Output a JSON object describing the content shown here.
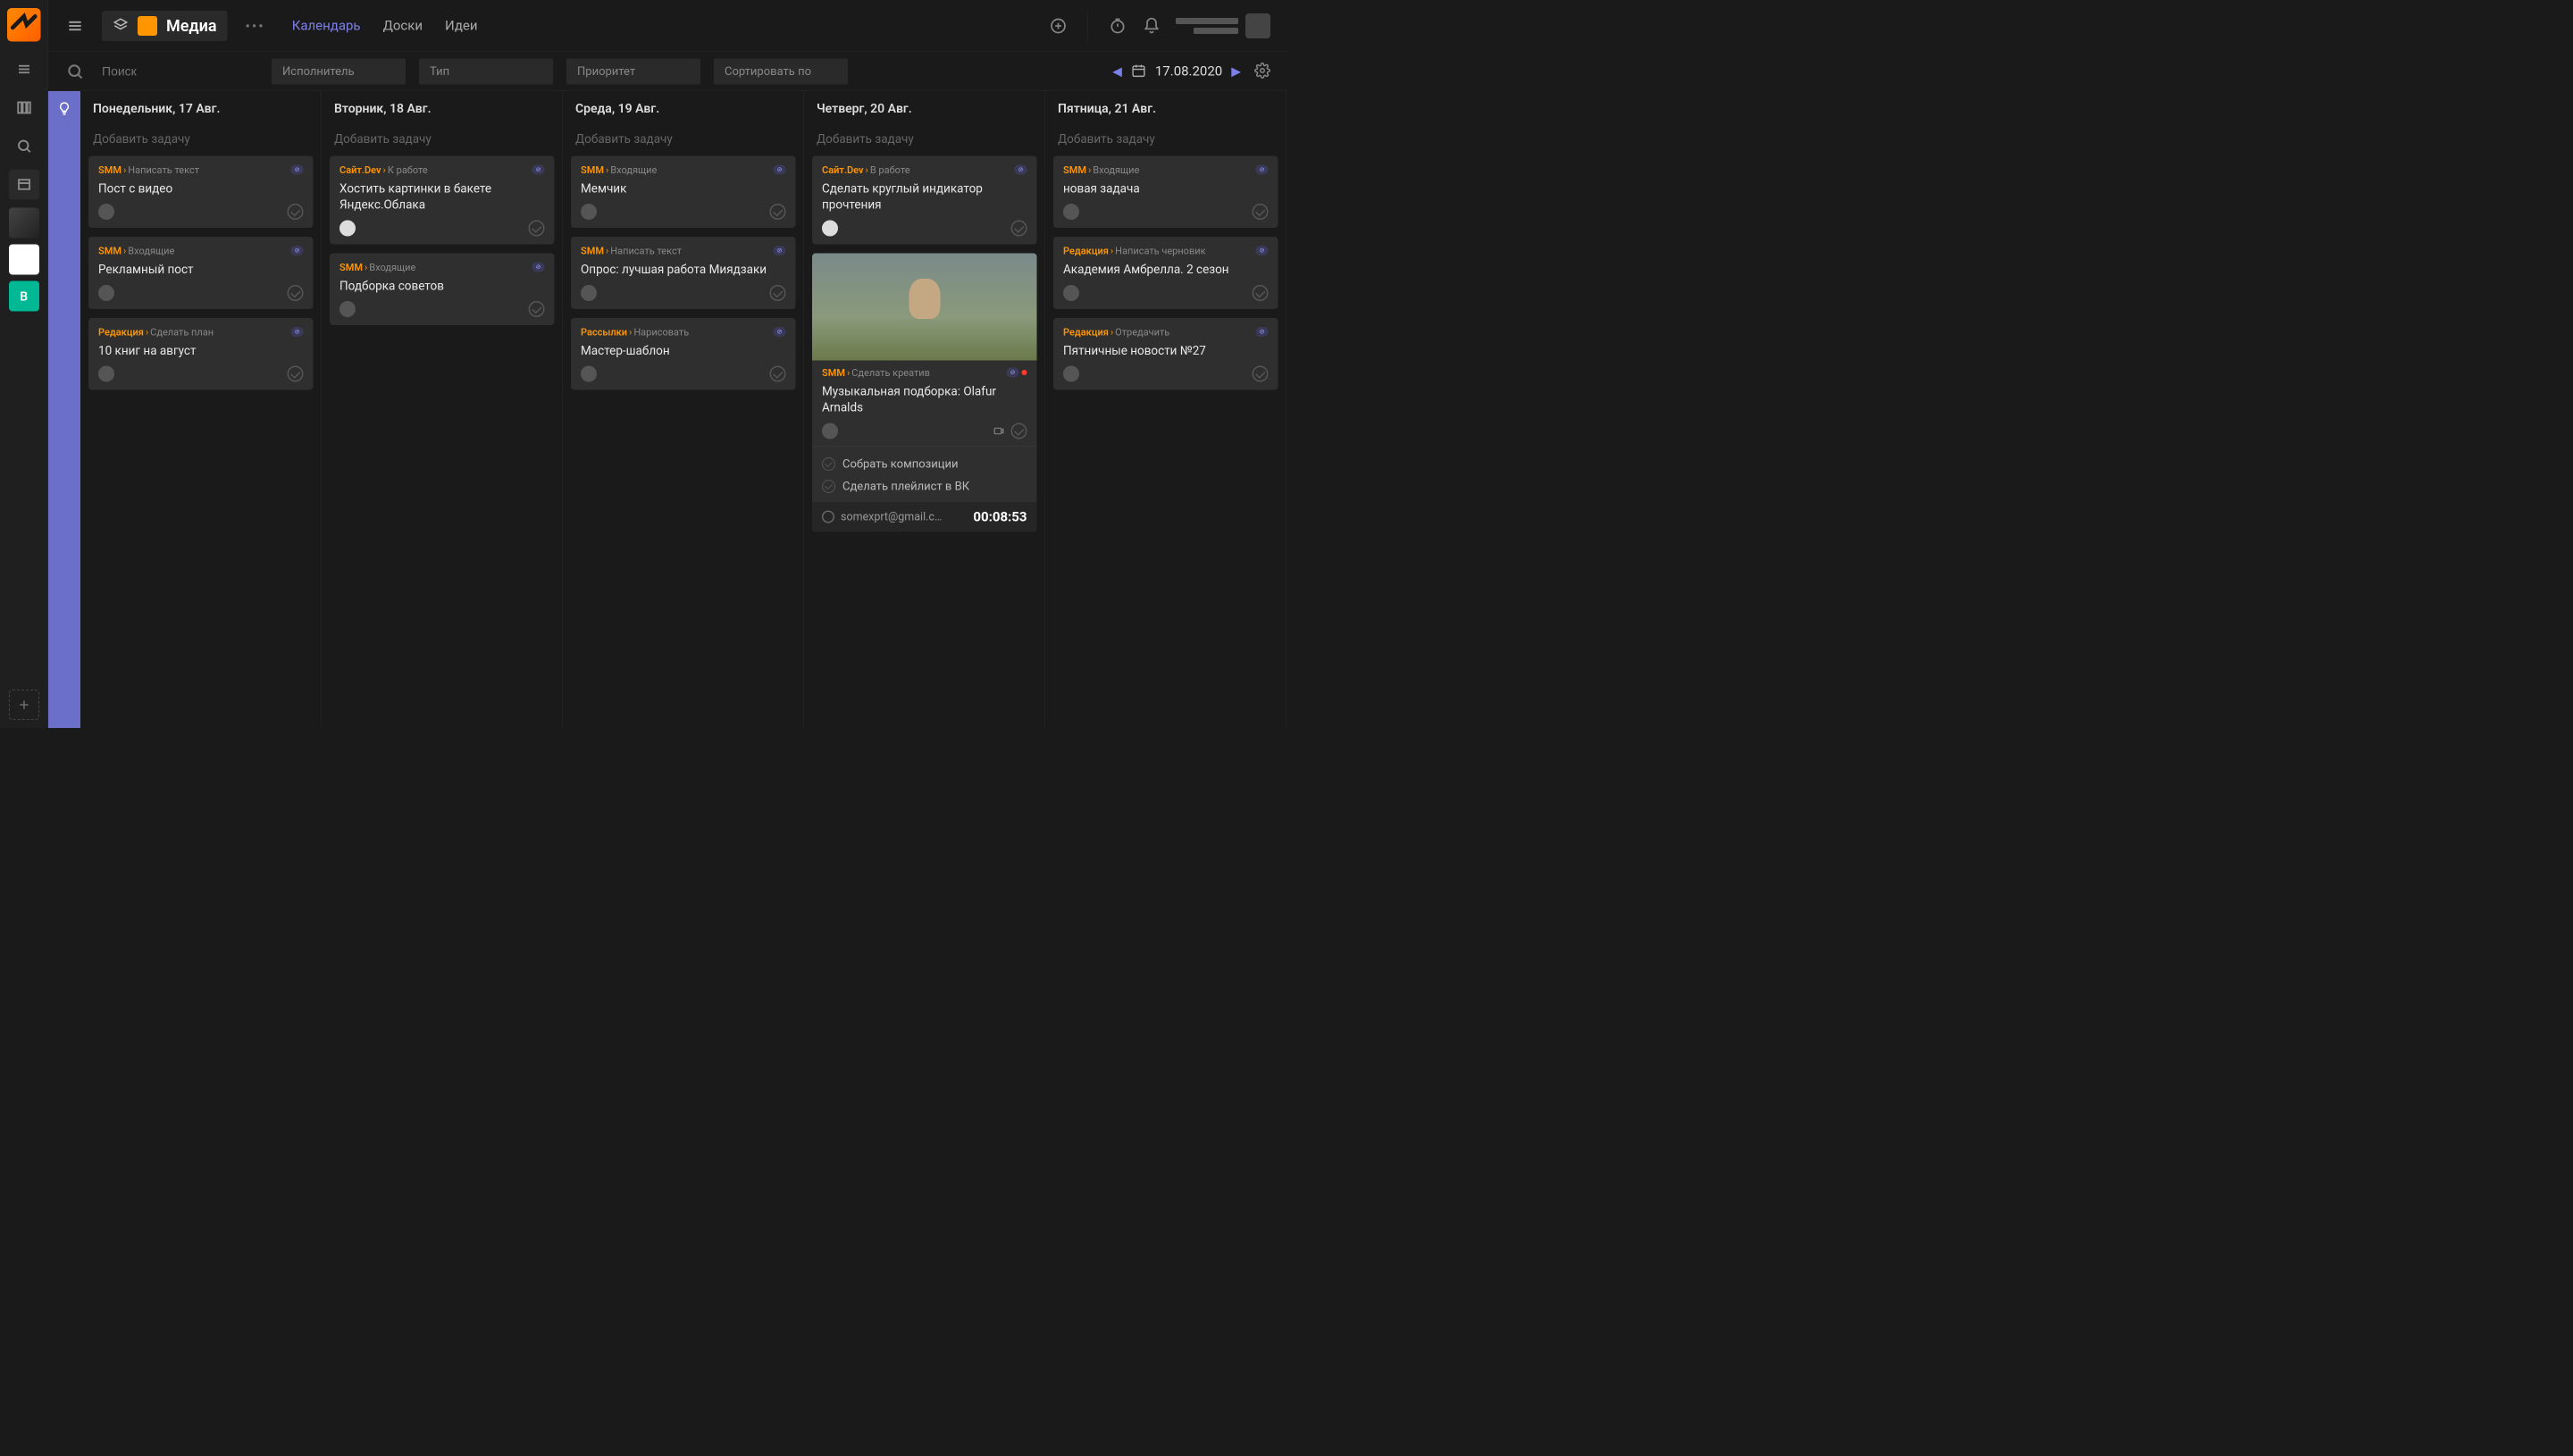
{
  "header": {
    "workspace_title": "Медиа",
    "tabs": [
      {
        "label": "Календарь",
        "active": true
      },
      {
        "label": "Доски",
        "active": false
      },
      {
        "label": "Идеи",
        "active": false
      }
    ]
  },
  "toolbar": {
    "search_placeholder": "Поиск",
    "filters": {
      "assignee": "Исполнитель",
      "type": "Тип",
      "priority": "Приоритет",
      "sort": "Сортировать по"
    },
    "date": "17.08.2020"
  },
  "rail": {
    "project_short": "В"
  },
  "columns": [
    {
      "title": "Понедельник, 17 Авг.",
      "add": "Добавить задачу",
      "cards": [
        {
          "cat": "SMM",
          "stage": "Написать текст",
          "title": "Пост с видео"
        },
        {
          "cat": "SMM",
          "stage": "Входящие",
          "title": "Рекламный пост"
        },
        {
          "cat": "Редакция",
          "stage": "Сделать план",
          "title": "10 книг на август"
        }
      ]
    },
    {
      "title": "Вторник, 18 Авг.",
      "add": "Добавить задачу",
      "cards": [
        {
          "cat": "Сайт.Dev",
          "stage": "К работе",
          "title": "Хостить картинки в бакете Яндекс.Облака",
          "avatar_light": true
        },
        {
          "cat": "SMM",
          "stage": "Входящие",
          "title": "Подборка советов"
        }
      ]
    },
    {
      "title": "Среда, 19 Авг.",
      "add": "Добавить задачу",
      "cards": [
        {
          "cat": "SMM",
          "stage": "Входящие",
          "title": "Мемчик"
        },
        {
          "cat": "SMM",
          "stage": "Написать текст",
          "title": "Опрос: лучшая работа Миядзаки"
        },
        {
          "cat": "Рассылки",
          "stage": "Нарисовать",
          "title": "Мастер-шаблон"
        }
      ]
    },
    {
      "title": "Четверг, 20 Авг.",
      "add": "Добавить задачу",
      "cards": [
        {
          "cat": "Сайт.Dev",
          "stage": "В работе",
          "title": "Сделать круглый индикатор прочтения",
          "avatar_light": true
        },
        {
          "cat": "SMM",
          "stage": "Сделать креатив",
          "title": "Музыкальная подборка: Olafur Arnalds",
          "has_image": true,
          "red_dot": true,
          "subtasks": [
            "Собрать композиции",
            "Сделать плейлист в ВК"
          ],
          "timer_email": "somexprt@gmail.c…",
          "timer_time": "00:08:53"
        }
      ]
    },
    {
      "title": "Пятница, 21 Авг.",
      "add": "Добавить задачу",
      "cards": [
        {
          "cat": "SMM",
          "stage": "Входящие",
          "title": "новая задача"
        },
        {
          "cat": "Редакция",
          "stage": "Написать черновик",
          "title": "Академия Амбрелла. 2 сезон"
        },
        {
          "cat": "Редакция",
          "stage": "Отредачить",
          "title": "Пятничные новости №27"
        }
      ]
    }
  ]
}
